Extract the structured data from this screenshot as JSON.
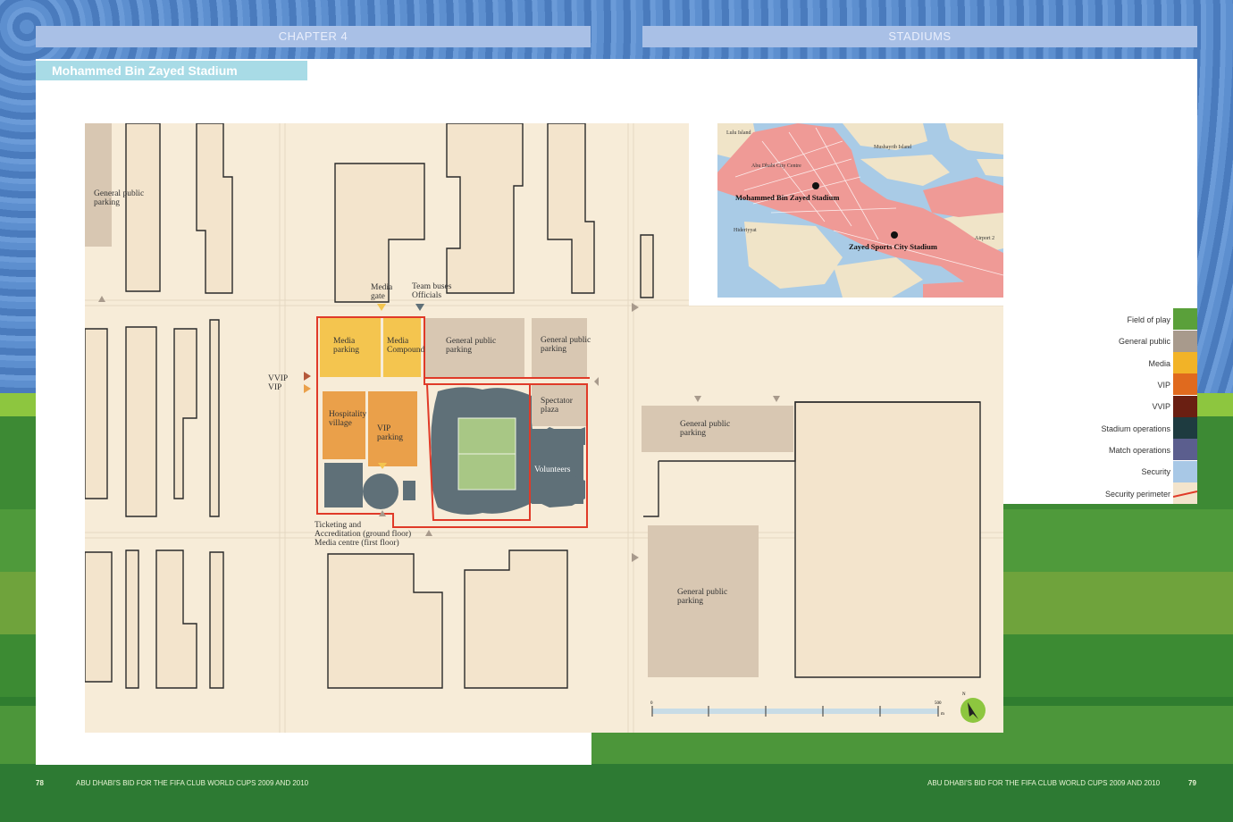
{
  "header": {
    "chapter": "CHAPTER 4",
    "section": "STADIUMS"
  },
  "title": "Mohammed Bin Zayed Stadium",
  "footer": {
    "left_page": "78",
    "left_text": "ABU DHABI'S BID FOR THE FIFA CLUB WORLD CUPS 2009 AND 2010",
    "right_text": "ABU DHABI'S BID FOR THE FIFA CLUB WORLD CUPS 2009 AND 2010",
    "right_page": "79"
  },
  "site_map": {
    "labels": {
      "gp_top_left": [
        "General public",
        "parking"
      ],
      "media_gate": [
        "Media",
        "gate"
      ],
      "team_buses": [
        "Team buses",
        "Officials"
      ],
      "media_parking": [
        "Media",
        "parking"
      ],
      "media_compound": [
        "Media",
        "Compound"
      ],
      "gp_mid1": [
        "General public",
        "parking"
      ],
      "gp_mid2": [
        "General public",
        "parking"
      ],
      "vvip": [
        "VVIP",
        "VIP"
      ],
      "hospitality": [
        "Hospitality",
        "village"
      ],
      "vip_parking": [
        "VIP",
        "parking"
      ],
      "spectator": [
        "Spectator",
        "plaza"
      ],
      "volunteers": "Volunteers",
      "gp_right": [
        "General public",
        "parking"
      ],
      "ticketing": [
        "Ticketing and",
        "Accreditation (ground floor)",
        "Media centre (first floor)"
      ],
      "gp_bottom": [
        "General public",
        "parking"
      ]
    },
    "scale": {
      "start": "0",
      "end": "500",
      "unit": "m"
    },
    "north": "N"
  },
  "inset_map": {
    "labels": {
      "lulu": "Lulu Island",
      "mushayrib": "Mushayrib Island",
      "city_centre": "Abu Dhabi City Centre",
      "mbz": "Mohammed Bin Zayed Stadium",
      "hideriyyat": "Hideriyyat",
      "airport": "Airport 2",
      "zayed": "Zayed Sports City Stadium"
    }
  },
  "legend": [
    {
      "label": "Field of play",
      "color": "#5aa03a"
    },
    {
      "label": "General public",
      "color": "#a89a8c"
    },
    {
      "label": "Media",
      "color": "#f2b327"
    },
    {
      "label": "VIP",
      "color": "#e06a1e"
    },
    {
      "label": "VVIP",
      "color": "#6a1f12"
    },
    {
      "label": "Stadium operations",
      "color": "#1e3b40"
    },
    {
      "label": "Match operations",
      "color": "#5b5e8e"
    },
    {
      "label": "Security",
      "color": "#a8c8e6"
    },
    {
      "label": "Security perimeter",
      "color": "#e03a28"
    }
  ],
  "colors": {
    "map_bg": "#f7ecd8",
    "building_fill": "#f3e4cc",
    "stadium": "#5f7078",
    "pitch": "#a8c785"
  }
}
